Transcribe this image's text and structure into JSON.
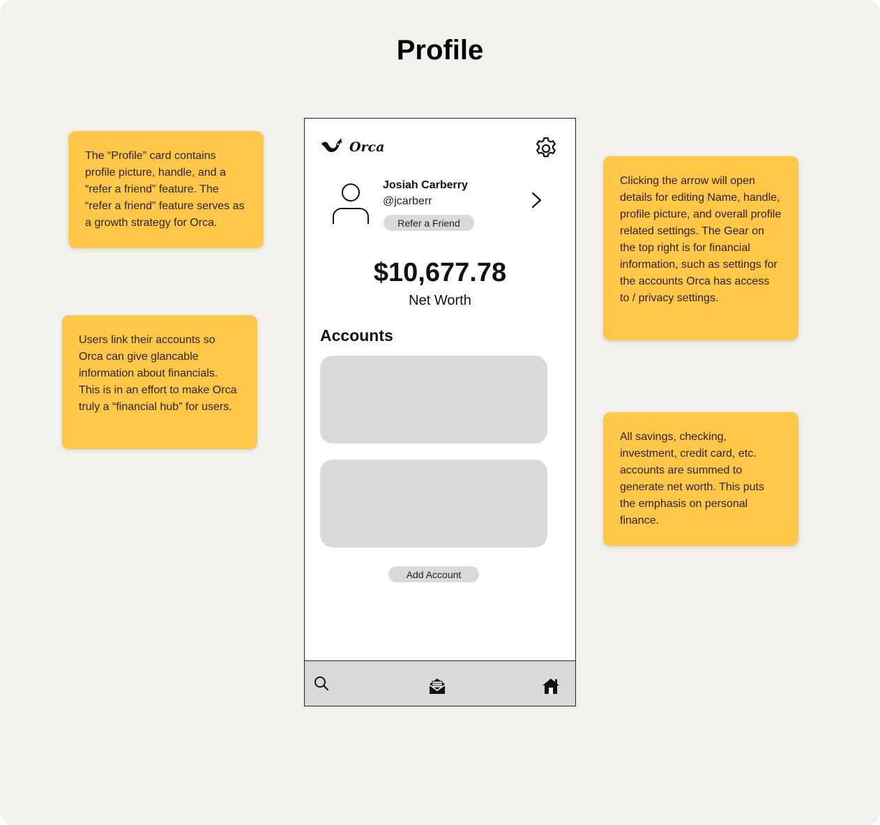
{
  "page": {
    "title": "Profile"
  },
  "notes": [
    "The “Profile” card contains profile picture, handle, and a “refer a friend” feature. The “refer a friend” feature serves as a growth strategy for Orca.",
    "Users link their accounts so Orca can give glancable information about financials. This is in an effort to make Orca truly a “financial hub” for users.",
    "Clicking the arrow will open details for editing Name, handle, profile picture, and overall profile related settings. The Gear on the top right is for financial information, such as settings for the accounts Orca has access to / privacy settings.",
    "All savings, checking, investment, credit card, etc. accounts are summed to generate net worth. This puts the emphasis on personal finance."
  ],
  "app": {
    "brand": "Orca",
    "icons": {
      "logo": "orca-whale-icon",
      "settings": "gear-icon",
      "avatar": "user-avatar-icon",
      "open_profile": "chevron-right-icon"
    },
    "profile": {
      "name": "Josiah Carberry",
      "handle": "@jcarberr",
      "refer_label": "Refer a Friend"
    },
    "net_worth": {
      "value": "$10,677.78",
      "label": "Net Worth"
    },
    "accounts": {
      "heading": "Accounts",
      "add_label": "Add Account"
    },
    "tabbar": {
      "items": [
        "search-icon",
        "mail-icon",
        "home-icon"
      ]
    }
  },
  "colors": {
    "board": "#f2f1ee",
    "note": "#ffc747",
    "placeholder": "#d9d9d9"
  }
}
